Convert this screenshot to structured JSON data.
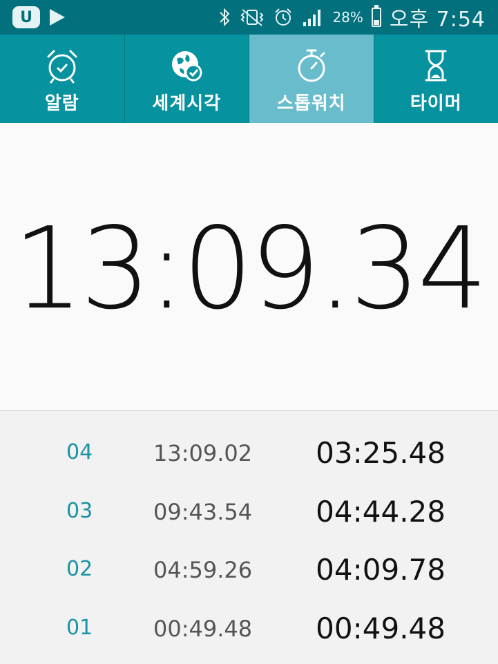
{
  "status_bar": {
    "app_badge": "U",
    "battery_percent": "28%",
    "battery_level": 0.28,
    "time": "오후 7:54",
    "icons": [
      "u-plus-app-icon",
      "play-icon",
      "bluetooth-icon",
      "vibrate-mode-icon",
      "alarm-clock-icon",
      "signal-strength-icon",
      "battery-icon"
    ]
  },
  "tabs": [
    {
      "label": "알람",
      "icon": "alarm-clock-icon",
      "active": false
    },
    {
      "label": "세계시각",
      "icon": "globe-check-icon",
      "active": false
    },
    {
      "label": "스톱워치",
      "icon": "stopwatch-icon",
      "active": true
    },
    {
      "label": "타이머",
      "icon": "hourglass-icon",
      "active": false
    }
  ],
  "stopwatch": {
    "elapsed": "13:09.34"
  },
  "laps": [
    {
      "number": "04",
      "total": "13:09.02",
      "split": "03:25.48"
    },
    {
      "number": "03",
      "total": "09:43.54",
      "split": "04:44.28"
    },
    {
      "number": "02",
      "total": "04:59.26",
      "split": "04:09.78"
    },
    {
      "number": "01",
      "total": "00:49.48",
      "split": "00:49.48"
    }
  ],
  "colors": {
    "status_bar": "#03707e",
    "tab_bar": "#07929f",
    "tab_active": "#68bccc",
    "lap_number": "#1a93a4"
  }
}
